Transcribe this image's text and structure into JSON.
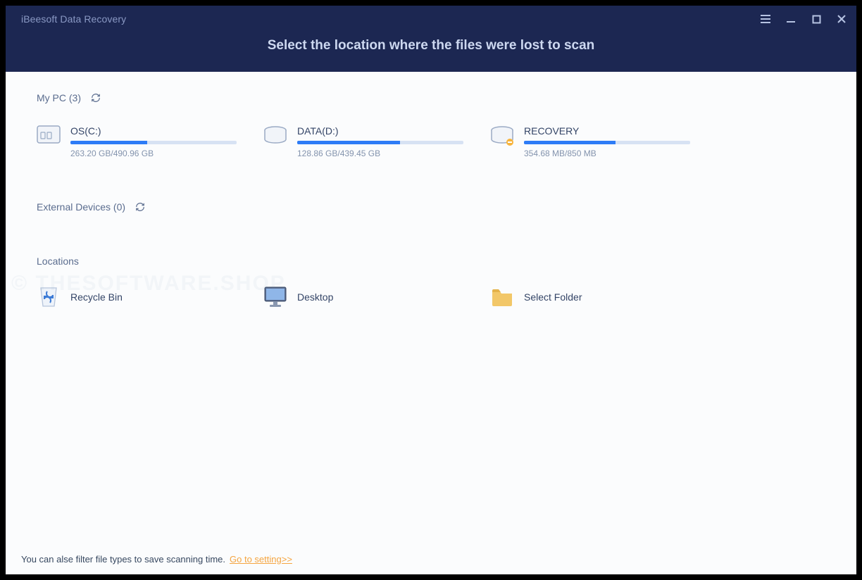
{
  "app_title": "iBeesoft Data Recovery",
  "instruction": "Select the location where the files were lost to scan",
  "watermark": "© THESOFTWARE.SHOP",
  "sections": {
    "mypc": {
      "label": "My PC (3)"
    },
    "external": {
      "label": "External Devices (0)"
    },
    "locations": {
      "label": "Locations"
    }
  },
  "drives": [
    {
      "name": "OS(C:)",
      "size": "263.20 GB/490.96 GB",
      "pct": 46,
      "warn": false
    },
    {
      "name": "DATA(D:)",
      "size": "128.86 GB/439.45 GB",
      "pct": 62,
      "warn": false
    },
    {
      "name": "RECOVERY",
      "size": "354.68 MB/850 MB",
      "pct": 55,
      "warn": true
    }
  ],
  "locations": [
    {
      "name": "Recycle Bin",
      "icon": "recycle-bin"
    },
    {
      "name": "Desktop",
      "icon": "desktop"
    },
    {
      "name": "Select Folder",
      "icon": "folder"
    }
  ],
  "footer": {
    "hint": "You can alse filter file types to save scanning time.",
    "link": "Go to setting>>"
  }
}
